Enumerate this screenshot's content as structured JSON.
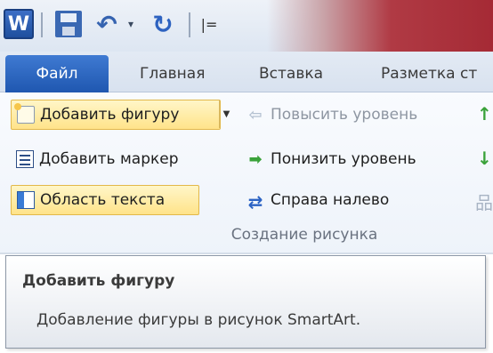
{
  "quick_access": {
    "app_icon_letter": "W",
    "undo_dropdown_glyph": "▾",
    "customize_glyph": "|="
  },
  "tabs": {
    "file": "Файл",
    "home": "Главная",
    "insert": "Вставка",
    "page_layout": "Разметка ст"
  },
  "ribbon": {
    "add_shape": "Добавить фигуру",
    "add_bullet": "Добавить маркер",
    "text_pane": "Область текста",
    "promote": "Повысить уровень",
    "demote": "Понизить уровень",
    "right_to_left": "Справа налево",
    "group_label": "Создание рисунка"
  },
  "icons": {
    "add_shape": "add-shape-icon",
    "add_bullet": "bullets-icon",
    "text_pane": "text-pane-icon",
    "promote": "arrow-left-icon",
    "demote": "arrow-right-icon",
    "right_to_left": "swap-arrows-icon",
    "layout": "org-chart-icon"
  },
  "tooltip": {
    "title": "Добавить фигуру",
    "description": "Добавление фигуры в рисунок SmartArt."
  },
  "colors": {
    "file_tab": "#2a63bd",
    "highlight": "#ffe38a",
    "title_bar_red": "#a52a35"
  }
}
